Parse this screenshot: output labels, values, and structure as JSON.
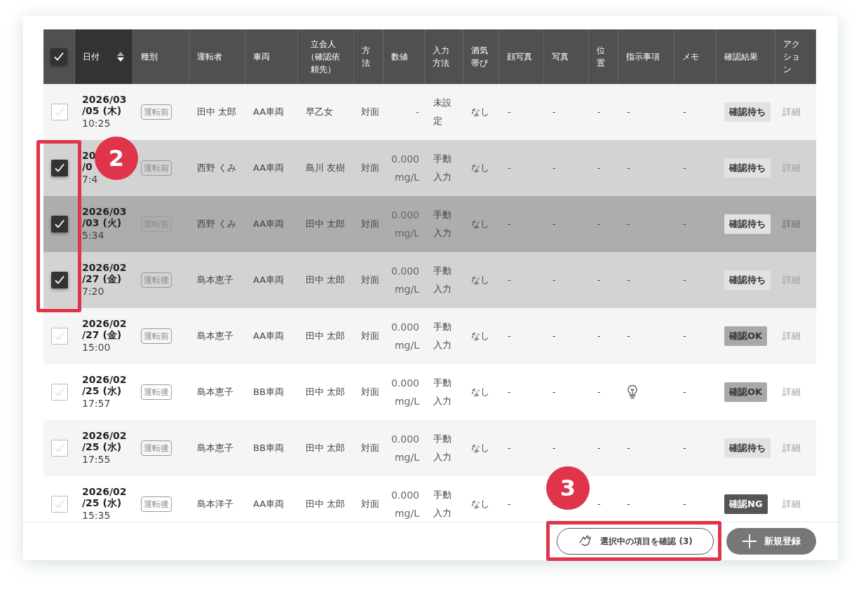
{
  "columns": [
    {
      "kind": "check",
      "checked": true
    },
    {
      "label": "日付",
      "sorted": true
    },
    {
      "label": "種別",
      "sorted": false
    },
    {
      "label": "運転者",
      "sorted": false
    },
    {
      "label": "車両",
      "sorted": false
    },
    {
      "label": "立会人（確認依頼先）",
      "sorted": false
    },
    {
      "label": "方法",
      "sorted": false
    },
    {
      "label": "数値",
      "sorted": false
    },
    {
      "label": "入力方法",
      "sorted": false
    },
    {
      "label": "酒気帯び",
      "sorted": false
    },
    {
      "label": "顔写真",
      "sorted": false
    },
    {
      "label": "写真",
      "sorted": false
    },
    {
      "label": "位置",
      "sorted": false
    },
    {
      "label": "指示事項",
      "sorted": false
    },
    {
      "label": "メモ",
      "sorted": false
    },
    {
      "label": "確認結果",
      "sorted": false
    },
    {
      "label": "アクション",
      "sorted": false
    }
  ],
  "rows": [
    {
      "checked": false,
      "hovered": false,
      "date": "2026/03",
      "day": "/05 (木)",
      "time": "10:25",
      "type": "運転前",
      "driver": "田中 太郎",
      "vehicle": "AA車両",
      "witness": "早乙女",
      "method": "対面",
      "value": "-",
      "input": "未設定",
      "alcohol": "なし",
      "face": "-",
      "photo": "-",
      "position": "-",
      "instruction_icon": false,
      "instruction": "-",
      "memo": "-",
      "result": {
        "kind": "pending",
        "label": "確認待ち"
      },
      "action": "詳細"
    },
    {
      "checked": true,
      "hovered": false,
      "date": "20",
      "day": "/0",
      "time": "7:4",
      "type": "運転前",
      "driver": "西野 くみ",
      "vehicle": "AA車両",
      "witness": "島川 友樹",
      "method": "対面",
      "value": "0.000 mg/L",
      "input": "手動入力",
      "alcohol": "なし",
      "face": "-",
      "photo": "-",
      "position": "-",
      "instruction_icon": false,
      "instruction": "-",
      "memo": "-",
      "result": {
        "kind": "pending",
        "label": "確認待ち"
      },
      "action": "詳細"
    },
    {
      "checked": true,
      "hovered": true,
      "date": "2026/03",
      "day": "/03 (火)",
      "time": "5:34",
      "type": "運転前",
      "driver": "西野 くみ",
      "vehicle": "AA車両",
      "witness": "田中 太郎",
      "method": "対面",
      "value": "0.000 mg/L",
      "input": "手動入力",
      "alcohol": "なし",
      "face": "-",
      "photo": "-",
      "position": "-",
      "instruction_icon": false,
      "instruction": "-",
      "memo": "-",
      "result": {
        "kind": "pending",
        "label": "確認待ち"
      },
      "action": "詳細"
    },
    {
      "checked": true,
      "hovered": false,
      "date": "2026/02",
      "day": "/27 (金)",
      "time": "7:20",
      "type": "運転後",
      "driver": "島本恵子",
      "vehicle": "AA車両",
      "witness": "田中 太郎",
      "method": "対面",
      "value": "0.000 mg/L",
      "input": "手動入力",
      "alcohol": "なし",
      "face": "-",
      "photo": "-",
      "position": "-",
      "instruction_icon": false,
      "instruction": "-",
      "memo": "-",
      "result": {
        "kind": "pending",
        "label": "確認待ち"
      },
      "action": "詳細"
    },
    {
      "checked": false,
      "hovered": false,
      "date": "2026/02",
      "day": "/27 (金)",
      "time": "15:00",
      "type": "運転前",
      "driver": "島本恵子",
      "vehicle": "AA車両",
      "witness": "田中 太郎",
      "method": "対面",
      "value": "0.000 mg/L",
      "input": "手動入力",
      "alcohol": "なし",
      "face": "-",
      "photo": "-",
      "position": "-",
      "instruction_icon": false,
      "instruction": "-",
      "memo": "-",
      "result": {
        "kind": "ok",
        "label": "確認OK"
      },
      "action": "詳細"
    },
    {
      "checked": false,
      "hovered": false,
      "date": "2026/02",
      "day": "/25 (水)",
      "time": "17:57",
      "type": "運転後",
      "driver": "島本恵子",
      "vehicle": "BB車両",
      "witness": "田中 太郎",
      "method": "対面",
      "value": "0.000 mg/L",
      "input": "手動入力",
      "alcohol": "なし",
      "face": "-",
      "photo": "-",
      "position": "-",
      "instruction_icon": true,
      "memo": "-",
      "result": {
        "kind": "ok",
        "label": "確認OK"
      },
      "action": "詳細"
    },
    {
      "checked": false,
      "hovered": false,
      "date": "2026/02",
      "day": "/25 (水)",
      "time": "17:55",
      "type": "運転後",
      "driver": "島本恵子",
      "vehicle": "BB車両",
      "witness": "田中 太郎",
      "method": "対面",
      "value": "0.000 mg/L",
      "input": "手動入力",
      "alcohol": "なし",
      "face": "-",
      "photo": "-",
      "position": "-",
      "instruction_icon": false,
      "instruction": "-",
      "memo": "-",
      "result": {
        "kind": "pending",
        "label": "確認待ち"
      },
      "action": "詳細"
    },
    {
      "checked": false,
      "hovered": false,
      "date": "2026/02",
      "day": "/25 (水)",
      "time": "15:35",
      "type": "運転後",
      "driver": "島本洋子",
      "vehicle": "AA車両",
      "witness": "田中 太郎",
      "method": "対面",
      "value": "0.000 mg/L",
      "input": "手動入力",
      "alcohol": "なし",
      "face": "-",
      "photo": "-",
      "position": "-",
      "instruction_icon": false,
      "instruction": "-",
      "memo": "-",
      "result": {
        "kind": "ng",
        "label": "確認NG"
      },
      "action": "詳細"
    }
  ],
  "footer": {
    "confirm_button": "選択中の項目を確認 (3)",
    "new_button": "新規登録"
  },
  "annotations": [
    {
      "label": "2"
    },
    {
      "label": "3"
    }
  ]
}
